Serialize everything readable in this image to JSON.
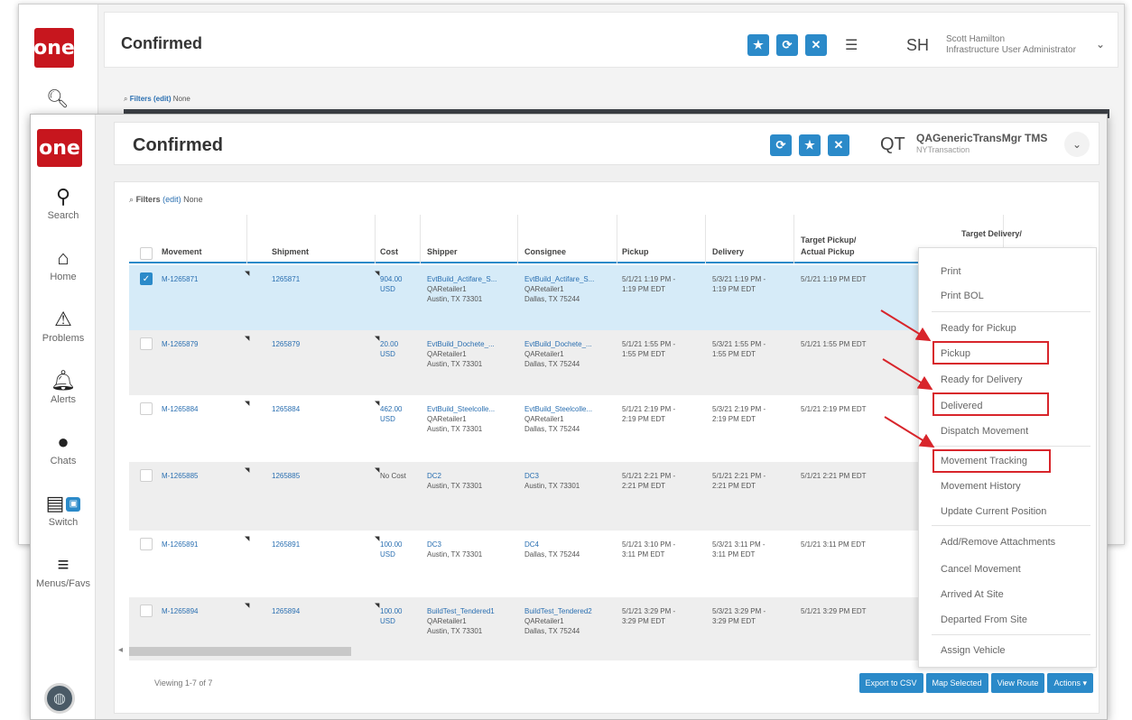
{
  "back_window": {
    "logo": "one",
    "title": "Confirmed",
    "avatar_initials": "SH",
    "user_name": "Scott Hamilton",
    "user_role": "Infrastructure User Administrator",
    "filters_label": "Filters",
    "filters_edit": "(edit)",
    "filters_value": "None"
  },
  "app": {
    "logo": "one",
    "title": "Confirmed",
    "avatar_initials": "QT",
    "user_name": "QAGenericTransMgr TMS",
    "user_role": "NYTransaction"
  },
  "nav": {
    "search": "Search",
    "home": "Home",
    "problems": "Problems",
    "alerts": "Alerts",
    "chats": "Chats",
    "switch": "Switch",
    "menus": "Menus/Favs"
  },
  "filters": {
    "label": "Filters",
    "edit": "(edit)",
    "value": "None"
  },
  "table": {
    "columns": {
      "movement": "Movement",
      "shipment": "Shipment",
      "cost": "Cost",
      "shipper": "Shipper",
      "consignee": "Consignee",
      "pickup": "Pickup",
      "delivery": "Delivery",
      "target_pickup_1": "Target Pickup/",
      "target_pickup_2": "Actual Pickup",
      "target_delivery_1": "Target Delivery/"
    },
    "rows": [
      {
        "movement": "M-1265871",
        "shipment": "1265871",
        "cost_1": "904.00",
        "cost_2": "USD",
        "shipper_1": "EvtBuild_Actifare_S...",
        "shipper_2": "QARetailer1",
        "shipper_3": "Austin, TX 73301",
        "consignee_1": "EvtBuild_Actifare_S...",
        "consignee_2": "QARetailer1",
        "consignee_3": "Dallas, TX 75244",
        "pickup_1": "5/1/21 1:19 PM -",
        "pickup_2": "1:19 PM EDT",
        "delivery_1": "5/3/21 1:19 PM -",
        "delivery_2": "1:19 PM EDT",
        "target_pickup": "5/1/21 1:19 PM EDT"
      },
      {
        "movement": "M-1265879",
        "shipment": "1265879",
        "cost_1": "20.00",
        "cost_2": "USD",
        "shipper_1": "EvtBuild_Dochete_...",
        "shipper_2": "QARetailer1",
        "shipper_3": "Austin, TX 73301",
        "consignee_1": "EvtBuild_Dochete_...",
        "consignee_2": "QARetailer1",
        "consignee_3": "Dallas, TX 75244",
        "pickup_1": "5/1/21 1:55 PM -",
        "pickup_2": "1:55 PM EDT",
        "delivery_1": "5/3/21 1:55 PM -",
        "delivery_2": "1:55 PM EDT",
        "target_pickup": "5/1/21 1:55 PM EDT"
      },
      {
        "movement": "M-1265884",
        "shipment": "1265884",
        "cost_1": "462.00",
        "cost_2": "USD",
        "shipper_1": "EvtBuild_Steelcolle...",
        "shipper_2": "QARetailer1",
        "shipper_3": "Austin, TX 73301",
        "consignee_1": "EvtBuild_Steelcolle...",
        "consignee_2": "QARetailer1",
        "consignee_3": "Dallas, TX 75244",
        "pickup_1": "5/1/21 2:19 PM -",
        "pickup_2": "2:19 PM EDT",
        "delivery_1": "5/3/21 2:19 PM -",
        "delivery_2": "2:19 PM EDT",
        "target_pickup": "5/1/21 2:19 PM EDT"
      },
      {
        "movement": "M-1265885",
        "shipment": "1265885",
        "cost_1": "No Cost",
        "cost_2": "",
        "shipper_1": "DC2",
        "shipper_2": "Austin, TX 73301",
        "shipper_3": "",
        "consignee_1": "DC3",
        "consignee_2": "Austin, TX 73301",
        "consignee_3": "",
        "pickup_1": "5/1/21 2:21 PM -",
        "pickup_2": "2:21 PM EDT",
        "delivery_1": "5/1/21 2:21 PM -",
        "delivery_2": "2:21 PM EDT",
        "target_pickup": "5/1/21 2:21 PM EDT"
      },
      {
        "movement": "M-1265891",
        "shipment": "1265891",
        "cost_1": "100.00",
        "cost_2": "USD",
        "shipper_1": "DC3",
        "shipper_2": "Austin, TX 73301",
        "shipper_3": "",
        "consignee_1": "DC4",
        "consignee_2": "Dallas, TX 75244",
        "consignee_3": "",
        "pickup_1": "5/1/21 3:10 PM -",
        "pickup_2": "3:11 PM EDT",
        "delivery_1": "5/3/21 3:11 PM -",
        "delivery_2": "3:11 PM EDT",
        "target_pickup": "5/1/21 3:11 PM EDT"
      },
      {
        "movement": "M-1265894",
        "shipment": "1265894",
        "cost_1": "100.00",
        "cost_2": "USD",
        "shipper_1": "BuildTest_Tendered1",
        "shipper_2": "QARetailer1",
        "shipper_3": "Austin, TX 73301",
        "consignee_1": "BuildTest_Tendered2",
        "consignee_2": "QARetailer1",
        "consignee_3": "Dallas, TX 75244",
        "pickup_1": "5/1/21 3:29 PM -",
        "pickup_2": "3:29 PM EDT",
        "delivery_1": "5/3/21 3:29 PM -",
        "delivery_2": "3:29 PM EDT",
        "target_pickup": "5/1/21 3:29 PM EDT"
      }
    ]
  },
  "footer": {
    "viewing": "Viewing 1-7 of 7",
    "export": "Export to CSV",
    "map": "Map Selected",
    "view_route": "View Route",
    "actions": "Actions ▾"
  },
  "menu": {
    "print": "Print",
    "print_bol": "Print BOL",
    "ready_pickup": "Ready for Pickup",
    "pickup": "Pickup",
    "ready_delivery": "Ready for Delivery",
    "delivered": "Delivered",
    "dispatch": "Dispatch Movement",
    "tracking": "Movement Tracking",
    "history": "Movement History",
    "update_position": "Update Current Position",
    "attachments": "Add/Remove Attachments",
    "cancel": "Cancel Movement",
    "arrived": "Arrived At Site",
    "departed": "Departed From Site",
    "assign_vehicle": "Assign Vehicle"
  },
  "colors": {
    "brand_red": "#c7161e",
    "accent_blue": "#2b8ac9",
    "highlight_red": "#d8252b",
    "selected_row": "#d6ebf8"
  }
}
